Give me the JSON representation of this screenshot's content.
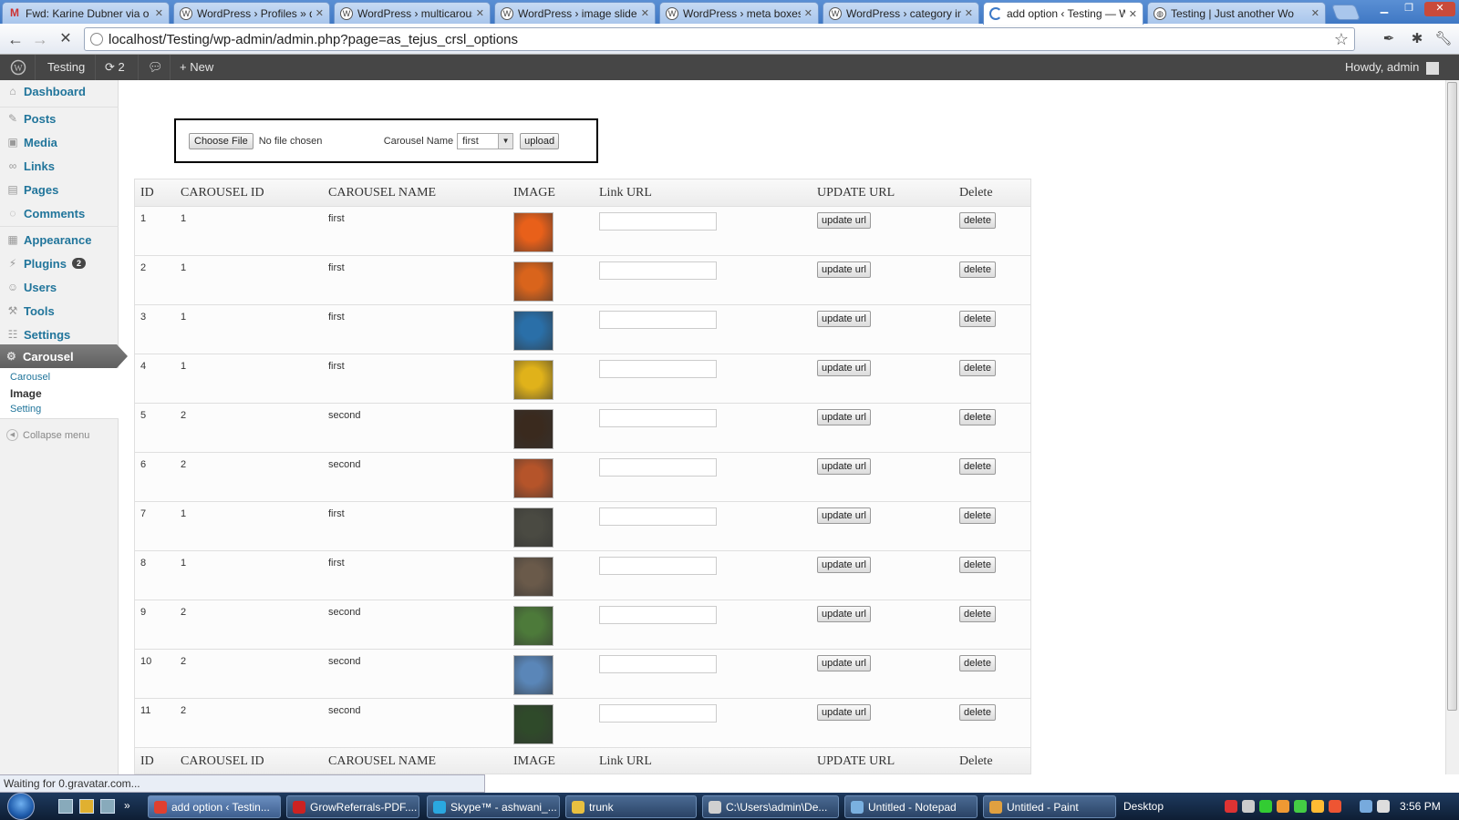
{
  "browser": {
    "tabs": [
      {
        "title": "Fwd: Karine Dubner via o",
        "icon": "gmail-icon",
        "active": false
      },
      {
        "title": "WordPress › Profiles » dh",
        "icon": "wordpress-icon",
        "active": false
      },
      {
        "title": "WordPress › multicarous",
        "icon": "wordpress-icon",
        "active": false
      },
      {
        "title": "WordPress › image slider",
        "icon": "wordpress-icon",
        "active": false
      },
      {
        "title": "WordPress › meta boxes",
        "icon": "wordpress-icon",
        "active": false
      },
      {
        "title": "WordPress › category im",
        "icon": "wordpress-icon",
        "active": false
      },
      {
        "title": "add option ‹ Testing — W",
        "icon": "loading-icon",
        "active": true
      },
      {
        "title": "Testing | Just another Wo",
        "icon": "globe-icon",
        "active": false
      }
    ],
    "url": "localhost/Testing/wp-admin/admin.php?page=as_tejus_crsl_options",
    "status": "Waiting for 0.gravatar.com..."
  },
  "adminbar": {
    "site": "Testing",
    "updates": "2",
    "new": "New",
    "howdy": "Howdy, admin"
  },
  "sidebar": {
    "items": [
      {
        "label": "Dashboard",
        "icon": "dashboard-icon"
      },
      {
        "label": "Posts",
        "icon": "pin-icon"
      },
      {
        "label": "Media",
        "icon": "media-icon"
      },
      {
        "label": "Links",
        "icon": "link-icon"
      },
      {
        "label": "Pages",
        "icon": "page-icon"
      },
      {
        "label": "Comments",
        "icon": "comment-icon"
      },
      {
        "label": "Appearance",
        "icon": "appearance-icon"
      },
      {
        "label": "Plugins",
        "icon": "plugin-icon",
        "badge": "2"
      },
      {
        "label": "Users",
        "icon": "users-icon"
      },
      {
        "label": "Tools",
        "icon": "tools-icon"
      },
      {
        "label": "Settings",
        "icon": "settings-icon"
      }
    ],
    "active_menu": "Carousel",
    "submenu": [
      "Carousel",
      "Image",
      "Setting"
    ],
    "current_submenu": "Image",
    "collapse": "Collapse menu"
  },
  "upload_form": {
    "choose_file": "Choose File",
    "no_file": "No file chosen",
    "carousel_label": "Carousel Name",
    "carousel_value": "first",
    "upload": "upload"
  },
  "table": {
    "headers": [
      "ID",
      "CAROUSEL ID",
      "CAROUSEL NAME",
      "IMAGE",
      "Link URL",
      "UPDATE URL",
      "Delete"
    ],
    "update_label": "update url",
    "delete_label": "delete",
    "rows": [
      {
        "id": "1",
        "carousel_id": "1",
        "name": "first",
        "thumb": "#e8601a"
      },
      {
        "id": "2",
        "carousel_id": "1",
        "name": "first",
        "thumb": "#d9641c"
      },
      {
        "id": "3",
        "carousel_id": "1",
        "name": "first",
        "thumb": "#2a6fa8"
      },
      {
        "id": "4",
        "carousel_id": "1",
        "name": "first",
        "thumb": "#e0b21a"
      },
      {
        "id": "5",
        "carousel_id": "2",
        "name": "second",
        "thumb": "#3a2a1e"
      },
      {
        "id": "6",
        "carousel_id": "2",
        "name": "second",
        "thumb": "#b5542a"
      },
      {
        "id": "7",
        "carousel_id": "1",
        "name": "first",
        "thumb": "#4a4a42"
      },
      {
        "id": "8",
        "carousel_id": "1",
        "name": "first",
        "thumb": "#6a5a4a"
      },
      {
        "id": "9",
        "carousel_id": "2",
        "name": "second",
        "thumb": "#4d7a3a"
      },
      {
        "id": "10",
        "carousel_id": "2",
        "name": "second",
        "thumb": "#5a86b8"
      },
      {
        "id": "11",
        "carousel_id": "2",
        "name": "second",
        "thumb": "#2f4a2a"
      }
    ]
  },
  "taskbar": {
    "tasks": [
      {
        "label": "add option ‹ Testin...",
        "color": "#e04030"
      },
      {
        "label": "GrowReferrals-PDF....",
        "color": "#cc2222"
      },
      {
        "label": "Skype™ - ashwani_...",
        "color": "#2aa8e0"
      },
      {
        "label": "trunk",
        "color": "#e8c040"
      },
      {
        "label": "C:\\Users\\admin\\De...",
        "color": "#d0d0d0"
      },
      {
        "label": "Untitled - Notepad",
        "color": "#7ab0e0"
      },
      {
        "label": "Untitled - Paint",
        "color": "#e0a040"
      }
    ],
    "desktop": "Desktop",
    "time": "3:56 PM"
  }
}
